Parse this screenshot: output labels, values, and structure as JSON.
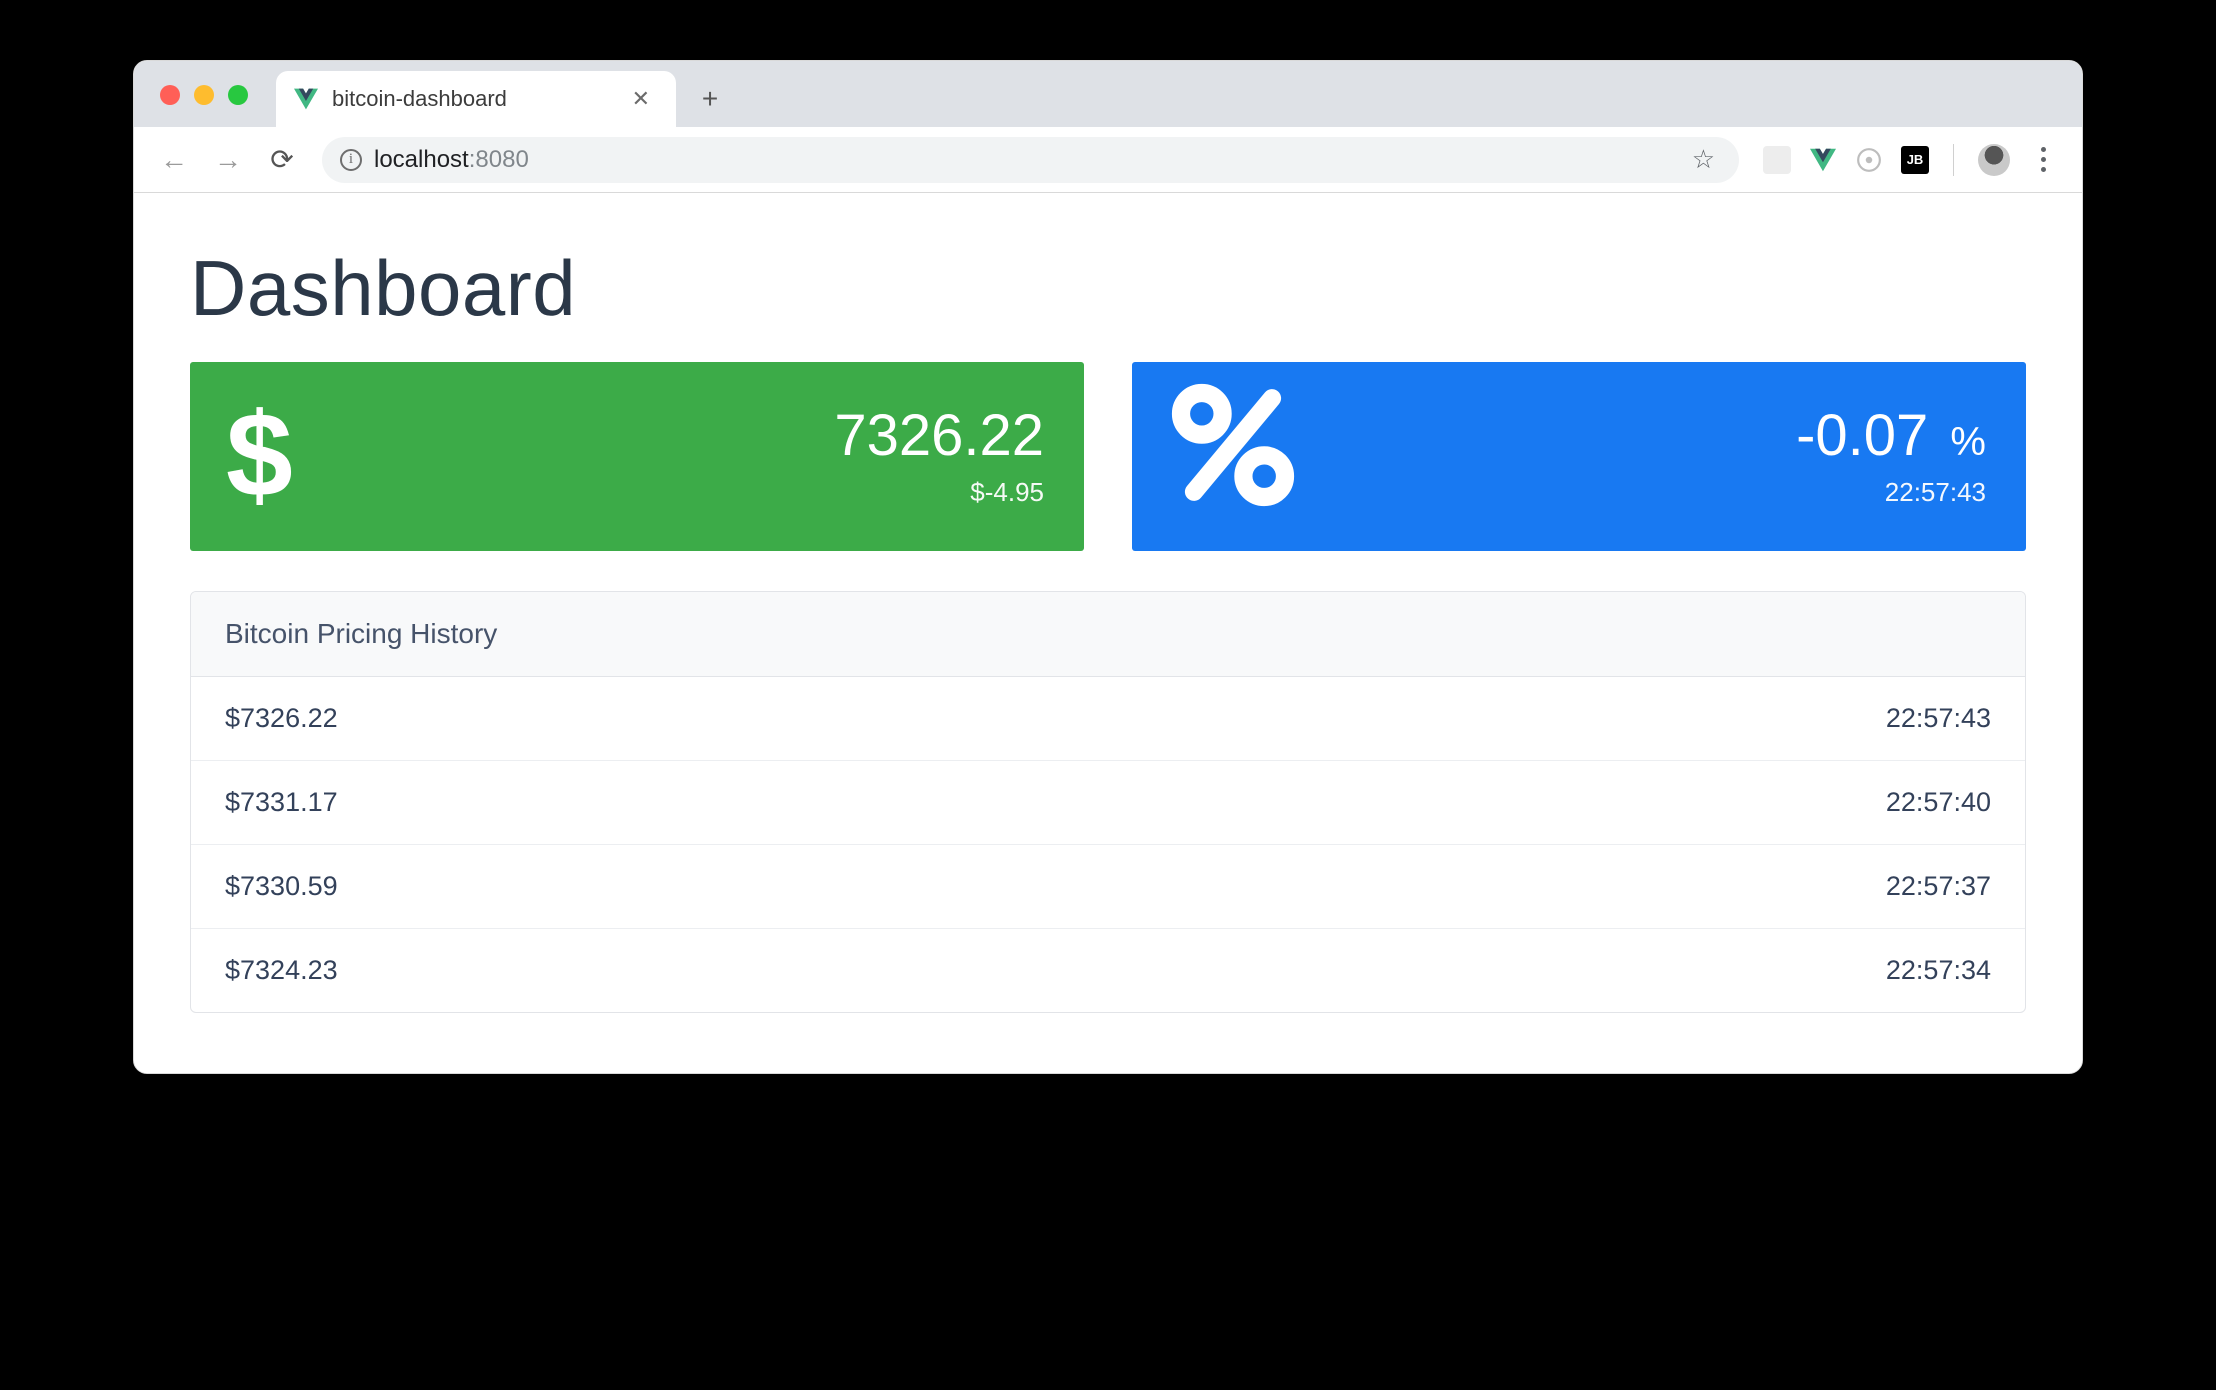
{
  "browser": {
    "tab_title": "bitcoin-dashboard",
    "url_host": "localhost",
    "url_port": ":8080"
  },
  "page": {
    "title": "Dashboard"
  },
  "cards": {
    "price": {
      "value": "7326.22",
      "delta": "$-4.95",
      "color": "#3cab48"
    },
    "change": {
      "value": "-0.07",
      "unit": "%",
      "timestamp": "22:57:43",
      "color": "#1879f2"
    }
  },
  "history": {
    "title": "Bitcoin Pricing History",
    "rows": [
      {
        "price": "$7326.22",
        "time": "22:57:43"
      },
      {
        "price": "$7331.17",
        "time": "22:57:40"
      },
      {
        "price": "$7330.59",
        "time": "22:57:37"
      },
      {
        "price": "$7324.23",
        "time": "22:57:34"
      }
    ]
  }
}
